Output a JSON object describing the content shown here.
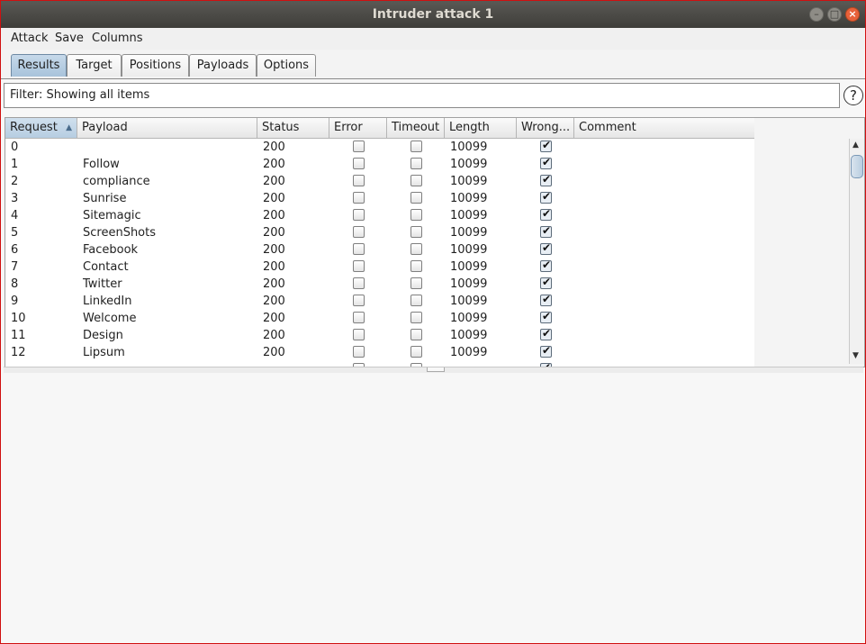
{
  "window": {
    "title": "Intruder attack 1"
  },
  "menu": [
    "Attack",
    "Save",
    "Columns"
  ],
  "tabs": [
    "Results",
    "Target",
    "Positions",
    "Payloads",
    "Options"
  ],
  "active_tab": "Results",
  "filter": {
    "text": "Filter: Showing all items"
  },
  "help_label": "?",
  "columns": [
    "Request",
    "Payload",
    "Status",
    "Error",
    "Timeout",
    "Length",
    "Wrong...",
    "Comment"
  ],
  "sorted_column": "Request",
  "rows": [
    {
      "request": "0",
      "payload": "",
      "status": "200",
      "error": false,
      "timeout": false,
      "length": "10099",
      "wrong": true,
      "comment": ""
    },
    {
      "request": "1",
      "payload": "Follow",
      "status": "200",
      "error": false,
      "timeout": false,
      "length": "10099",
      "wrong": true,
      "comment": ""
    },
    {
      "request": "2",
      "payload": "compliance",
      "status": "200",
      "error": false,
      "timeout": false,
      "length": "10099",
      "wrong": true,
      "comment": ""
    },
    {
      "request": "3",
      "payload": "Sunrise",
      "status": "200",
      "error": false,
      "timeout": false,
      "length": "10099",
      "wrong": true,
      "comment": ""
    },
    {
      "request": "4",
      "payload": "Sitemagic",
      "status": "200",
      "error": false,
      "timeout": false,
      "length": "10099",
      "wrong": true,
      "comment": ""
    },
    {
      "request": "5",
      "payload": "ScreenShots",
      "status": "200",
      "error": false,
      "timeout": false,
      "length": "10099",
      "wrong": true,
      "comment": ""
    },
    {
      "request": "6",
      "payload": "Facebook",
      "status": "200",
      "error": false,
      "timeout": false,
      "length": "10099",
      "wrong": true,
      "comment": ""
    },
    {
      "request": "7",
      "payload": "Contact",
      "status": "200",
      "error": false,
      "timeout": false,
      "length": "10099",
      "wrong": true,
      "comment": ""
    },
    {
      "request": "8",
      "payload": "Twitter",
      "status": "200",
      "error": false,
      "timeout": false,
      "length": "10099",
      "wrong": true,
      "comment": ""
    },
    {
      "request": "9",
      "payload": "LinkedIn",
      "status": "200",
      "error": false,
      "timeout": false,
      "length": "10099",
      "wrong": true,
      "comment": ""
    },
    {
      "request": "10",
      "payload": "Welcome",
      "status": "200",
      "error": false,
      "timeout": false,
      "length": "10099",
      "wrong": true,
      "comment": ""
    },
    {
      "request": "11",
      "payload": "Design",
      "status": "200",
      "error": false,
      "timeout": false,
      "length": "10099",
      "wrong": true,
      "comment": ""
    },
    {
      "request": "12",
      "payload": "Lipsum",
      "status": "200",
      "error": false,
      "timeout": false,
      "length": "10099",
      "wrong": true,
      "comment": ""
    }
  ]
}
